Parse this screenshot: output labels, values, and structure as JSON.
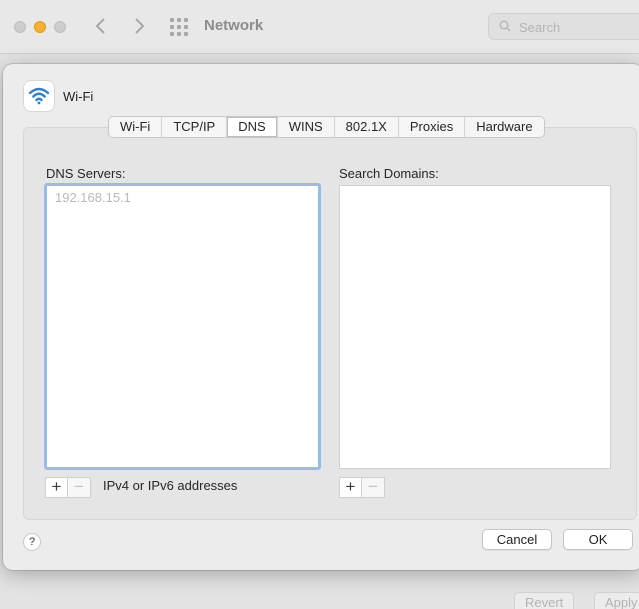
{
  "window": {
    "title": "Network"
  },
  "search": {
    "placeholder": "Search"
  },
  "background_buttons": {
    "revert": "Revert",
    "apply": "Apply"
  },
  "sheet": {
    "interface_name": "Wi-Fi",
    "tabs": [
      {
        "label": "Wi-Fi",
        "active": false
      },
      {
        "label": "TCP/IP",
        "active": false
      },
      {
        "label": "DNS",
        "active": true
      },
      {
        "label": "WINS",
        "active": false
      },
      {
        "label": "802.1X",
        "active": false
      },
      {
        "label": "Proxies",
        "active": false
      },
      {
        "label": "Hardware",
        "active": false
      }
    ],
    "dns": {
      "label": "DNS Servers:",
      "entries": [
        "192.168.15.1"
      ],
      "hint": "IPv4 or IPv6 addresses"
    },
    "domains": {
      "label": "Search Domains:",
      "entries": []
    },
    "plus_symbol": "+",
    "minus_symbol": "−",
    "help": "?",
    "cancel_label": "Cancel",
    "ok_label": "OK"
  },
  "colors": {
    "accent_focus": "#9bbbe4",
    "wifi_icon": "#2f7fd6",
    "minimize_button": "#f5b12f"
  }
}
